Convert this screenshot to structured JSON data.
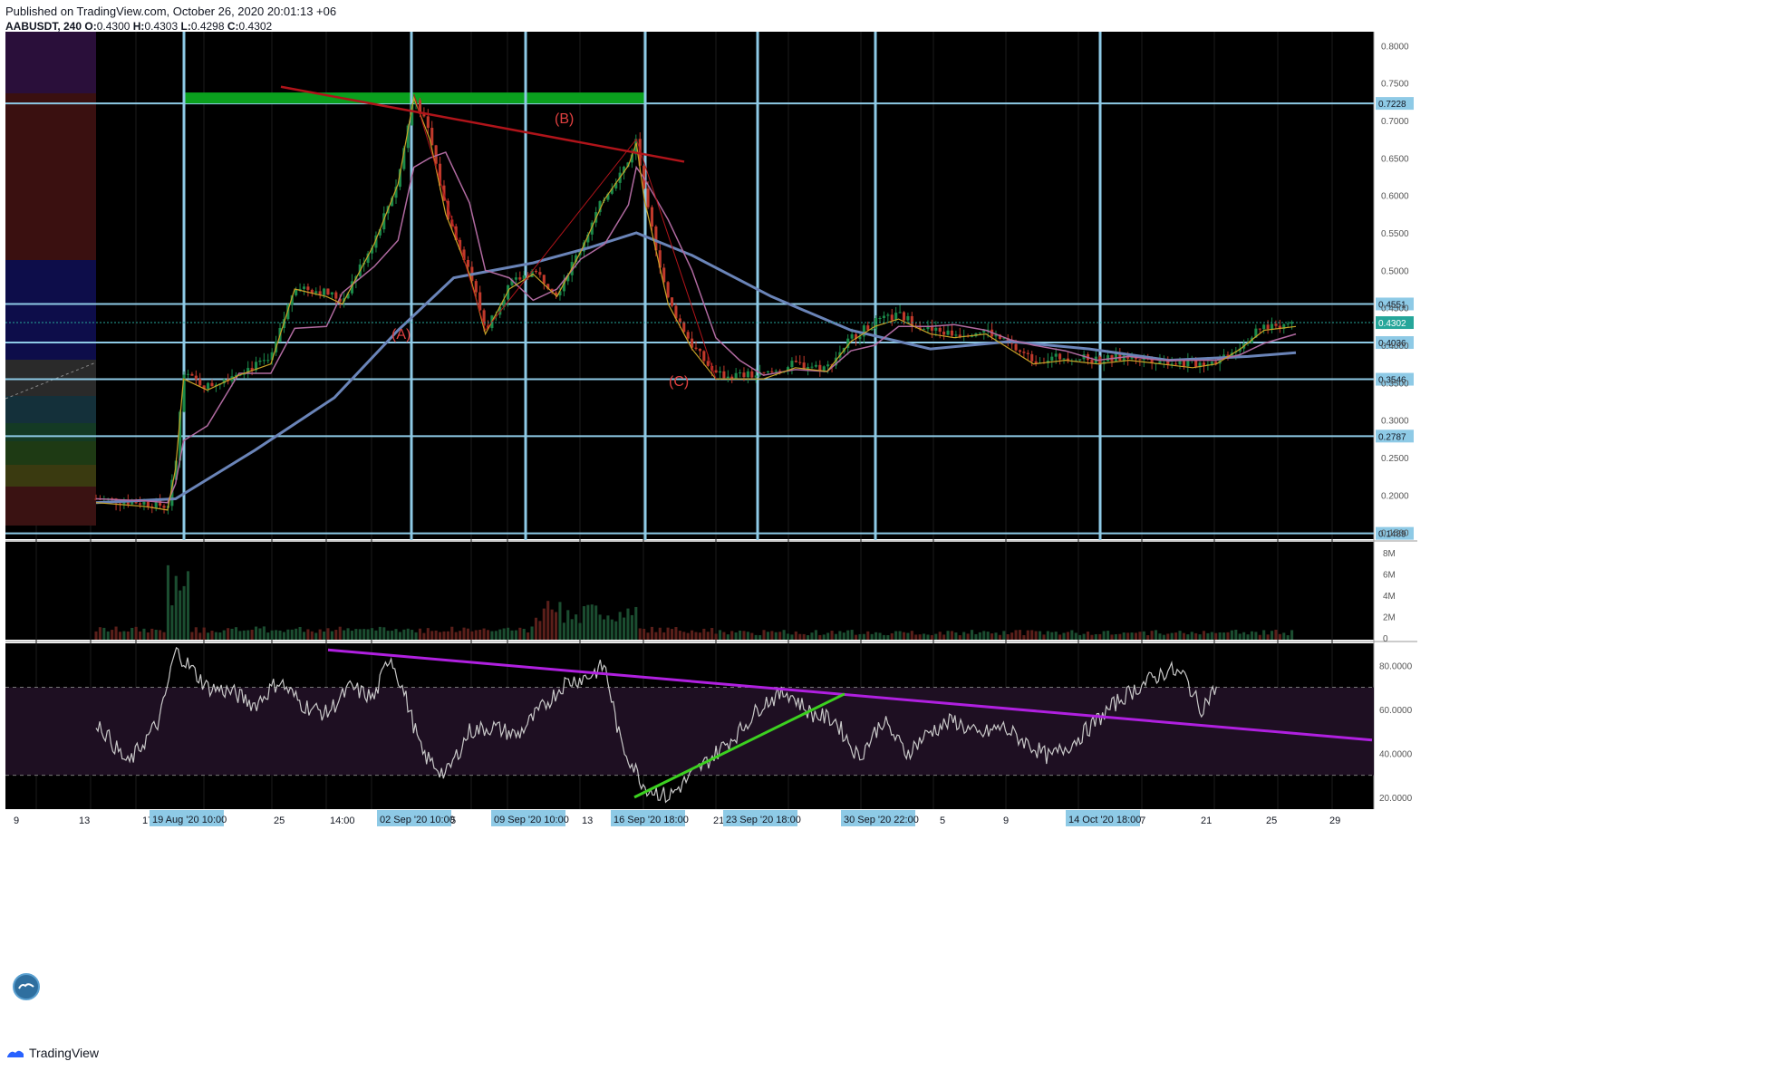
{
  "header": {
    "published": "Published on TradingView.com, October 26, 2020 20:01:13 +06",
    "symbol": "AABUSDT, 240",
    "o_label": "O:",
    "o": "0.4300",
    "h_label": "H:",
    "h": "0.4303",
    "l_label": "L:",
    "l": "0.4298",
    "c_label": "C:",
    "c": "0.4302"
  },
  "footer": {
    "brand": "TradingView",
    "logo_icon": "tradingview-logo-icon"
  },
  "colors": {
    "background": "#000000",
    "horizontal_lines": "#8ecae6",
    "vertical_lines": "#8ecae6",
    "up_candle": "#1b8a4a",
    "down_candle": "#c0392b",
    "ma_fast": "#c9a227",
    "ma_mid": "#b06aa0",
    "ma_slow": "#6a84b8",
    "trendline_red": "#b0141a",
    "rsi_line": "#c8c8c8",
    "rsi_trend_purple": "#b020e0",
    "rsi_trend_green": "#3cd020",
    "green_zone": "#0aa01e",
    "current_price": "#26a69a"
  },
  "chart_data": {
    "type": "line",
    "title": "",
    "symbol": "AABUSDT",
    "interval": "240",
    "price_axis": {
      "ticks": [
        "0.8000",
        "0.7500",
        "0.7000",
        "0.6500",
        "0.6000",
        "0.5500",
        "0.5000",
        "0.4500",
        "0.4000",
        "0.3500",
        "0.3000",
        "0.2500",
        "0.2000",
        "0.1500"
      ],
      "ylim": [
        0.14,
        0.81
      ]
    },
    "horizontal_levels": [
      {
        "value": 0.7228,
        "label": "0.7228"
      },
      {
        "value": 0.4551,
        "label": "0.4551"
      },
      {
        "value": 0.4036,
        "label": "0.4036"
      },
      {
        "value": 0.3546,
        "label": "0.3546"
      },
      {
        "value": 0.2787,
        "label": "0.2787"
      },
      {
        "value": 0.1489,
        "label": "0.1489"
      }
    ],
    "current_price": {
      "value": 0.4302,
      "label": "0.4302"
    },
    "time_axis": {
      "labels": [
        "9",
        "13",
        "17",
        "25",
        "14:00",
        "5",
        "13",
        "21",
        "5",
        "9",
        "17",
        "21",
        "25",
        "29"
      ],
      "highlighted_labels": [
        "19 Aug '20  10:00",
        "02 Sep '20  10:00",
        "09 Sep '20  10:00",
        "16 Sep '20  18:00",
        "23 Sep '20  18:00",
        "30 Sep '20  22:00",
        "14 Oct '20  18:00"
      ]
    },
    "wave_labels": [
      "(A)",
      "(B)",
      "(C)"
    ],
    "price_path": [
      {
        "x": 0,
        "y": 0.195
      },
      {
        "x": 6,
        "y": 0.19
      },
      {
        "x": 9,
        "y": 0.185
      },
      {
        "x": 10,
        "y": 0.24
      },
      {
        "x": 11,
        "y": 0.36
      },
      {
        "x": 14,
        "y": 0.345
      },
      {
        "x": 18,
        "y": 0.365
      },
      {
        "x": 22,
        "y": 0.38
      },
      {
        "x": 25,
        "y": 0.48
      },
      {
        "x": 29,
        "y": 0.47
      },
      {
        "x": 31,
        "y": 0.46
      },
      {
        "x": 35,
        "y": 0.54
      },
      {
        "x": 38,
        "y": 0.62
      },
      {
        "x": 40,
        "y": 0.735
      },
      {
        "x": 42,
        "y": 0.68
      },
      {
        "x": 44,
        "y": 0.58
      },
      {
        "x": 47,
        "y": 0.5
      },
      {
        "x": 49,
        "y": 0.42
      },
      {
        "x": 52,
        "y": 0.48
      },
      {
        "x": 55,
        "y": 0.5
      },
      {
        "x": 58,
        "y": 0.47
      },
      {
        "x": 61,
        "y": 0.53
      },
      {
        "x": 64,
        "y": 0.6
      },
      {
        "x": 67,
        "y": 0.645
      },
      {
        "x": 68,
        "y": 0.675
      },
      {
        "x": 69,
        "y": 0.6
      },
      {
        "x": 72,
        "y": 0.46
      },
      {
        "x": 75,
        "y": 0.4
      },
      {
        "x": 78,
        "y": 0.36
      },
      {
        "x": 81,
        "y": 0.36
      },
      {
        "x": 84,
        "y": 0.36
      },
      {
        "x": 88,
        "y": 0.375
      },
      {
        "x": 92,
        "y": 0.37
      },
      {
        "x": 95,
        "y": 0.41
      },
      {
        "x": 98,
        "y": 0.43
      },
      {
        "x": 101,
        "y": 0.44
      },
      {
        "x": 105,
        "y": 0.42
      },
      {
        "x": 108,
        "y": 0.415
      },
      {
        "x": 112,
        "y": 0.42
      },
      {
        "x": 115,
        "y": 0.4
      },
      {
        "x": 118,
        "y": 0.38
      },
      {
        "x": 122,
        "y": 0.385
      },
      {
        "x": 126,
        "y": 0.38
      },
      {
        "x": 130,
        "y": 0.385
      },
      {
        "x": 134,
        "y": 0.38
      },
      {
        "x": 138,
        "y": 0.375
      },
      {
        "x": 141,
        "y": 0.38
      },
      {
        "x": 144,
        "y": 0.4
      },
      {
        "x": 147,
        "y": 0.425
      },
      {
        "x": 151,
        "y": 0.43
      }
    ],
    "ma_slow_path": [
      {
        "x": 0,
        "y": 0.19
      },
      {
        "x": 10,
        "y": 0.195
      },
      {
        "x": 20,
        "y": 0.26
      },
      {
        "x": 30,
        "y": 0.33
      },
      {
        "x": 38,
        "y": 0.42
      },
      {
        "x": 45,
        "y": 0.49
      },
      {
        "x": 55,
        "y": 0.51
      },
      {
        "x": 62,
        "y": 0.53
      },
      {
        "x": 68,
        "y": 0.55
      },
      {
        "x": 75,
        "y": 0.52
      },
      {
        "x": 85,
        "y": 0.465
      },
      {
        "x": 95,
        "y": 0.42
      },
      {
        "x": 105,
        "y": 0.395
      },
      {
        "x": 115,
        "y": 0.405
      },
      {
        "x": 125,
        "y": 0.395
      },
      {
        "x": 135,
        "y": 0.38
      },
      {
        "x": 145,
        "y": 0.385
      },
      {
        "x": 151,
        "y": 0.39
      }
    ],
    "volume_axis": {
      "ticks": [
        "8M",
        "6M",
        "4M",
        "2M",
        "0"
      ],
      "ylim": [
        0,
        8
      ]
    },
    "rsi_axis": {
      "ticks": [
        "80.0000",
        "60.0000",
        "40.0000",
        "20.0000"
      ],
      "ylim": [
        15,
        90
      ],
      "upper_band": 70,
      "lower_band": 30
    },
    "rsi_path": [
      {
        "x": 0,
        "y": 55
      },
      {
        "x": 4,
        "y": 35
      },
      {
        "x": 8,
        "y": 55
      },
      {
        "x": 10,
        "y": 87
      },
      {
        "x": 14,
        "y": 70
      },
      {
        "x": 17,
        "y": 68
      },
      {
        "x": 20,
        "y": 62
      },
      {
        "x": 23,
        "y": 73
      },
      {
        "x": 26,
        "y": 62
      },
      {
        "x": 29,
        "y": 58
      },
      {
        "x": 32,
        "y": 70
      },
      {
        "x": 35,
        "y": 65
      },
      {
        "x": 37,
        "y": 85
      },
      {
        "x": 39,
        "y": 65
      },
      {
        "x": 41,
        "y": 40
      },
      {
        "x": 44,
        "y": 30
      },
      {
        "x": 47,
        "y": 50
      },
      {
        "x": 50,
        "y": 52
      },
      {
        "x": 53,
        "y": 48
      },
      {
        "x": 56,
        "y": 60
      },
      {
        "x": 59,
        "y": 72
      },
      {
        "x": 62,
        "y": 75
      },
      {
        "x": 64,
        "y": 80
      },
      {
        "x": 66,
        "y": 45
      },
      {
        "x": 69,
        "y": 25
      },
      {
        "x": 72,
        "y": 20
      },
      {
        "x": 75,
        "y": 30
      },
      {
        "x": 78,
        "y": 40
      },
      {
        "x": 81,
        "y": 50
      },
      {
        "x": 84,
        "y": 63
      },
      {
        "x": 87,
        "y": 68
      },
      {
        "x": 90,
        "y": 58
      },
      {
        "x": 93,
        "y": 55
      },
      {
        "x": 96,
        "y": 38
      },
      {
        "x": 99,
        "y": 55
      },
      {
        "x": 102,
        "y": 40
      },
      {
        "x": 105,
        "y": 50
      },
      {
        "x": 108,
        "y": 55
      },
      {
        "x": 111,
        "y": 48
      },
      {
        "x": 114,
        "y": 52
      },
      {
        "x": 117,
        "y": 45
      },
      {
        "x": 120,
        "y": 38
      },
      {
        "x": 123,
        "y": 45
      },
      {
        "x": 126,
        "y": 55
      },
      {
        "x": 129,
        "y": 65
      },
      {
        "x": 132,
        "y": 72
      },
      {
        "x": 135,
        "y": 78
      },
      {
        "x": 137,
        "y": 75
      },
      {
        "x": 139,
        "y": 60
      },
      {
        "x": 141,
        "y": 70
      }
    ]
  }
}
